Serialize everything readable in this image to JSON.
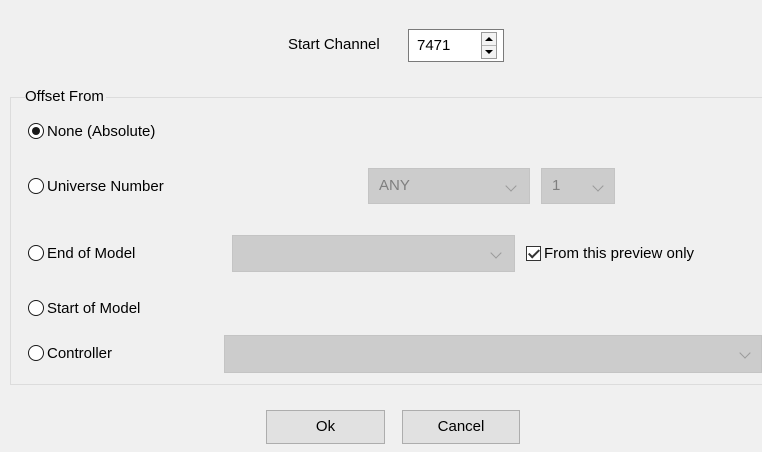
{
  "start_channel": {
    "label": "Start Channel",
    "value": "7471"
  },
  "offset": {
    "group_title": "Offset From",
    "options": [
      {
        "label": "None (Absolute)",
        "checked": true
      },
      {
        "label": "Universe Number",
        "checked": false
      },
      {
        "label": "End of Model",
        "checked": false
      },
      {
        "label": "Start of Model",
        "checked": false
      },
      {
        "label": "Controller",
        "checked": false
      }
    ],
    "universe_combo": {
      "value": "ANY"
    },
    "universe_sub_combo": {
      "value": "1"
    },
    "end_model_combo": {
      "value": ""
    },
    "controller_combo": {
      "value": ""
    },
    "preview_only": {
      "label": "From this preview only",
      "checked": true
    }
  },
  "buttons": {
    "ok": "Ok",
    "cancel": "Cancel"
  },
  "colors": {
    "dialog_bg": "#f0f0f0",
    "disabled_field": "#cccccc",
    "button_bg": "#e1e1e1"
  }
}
